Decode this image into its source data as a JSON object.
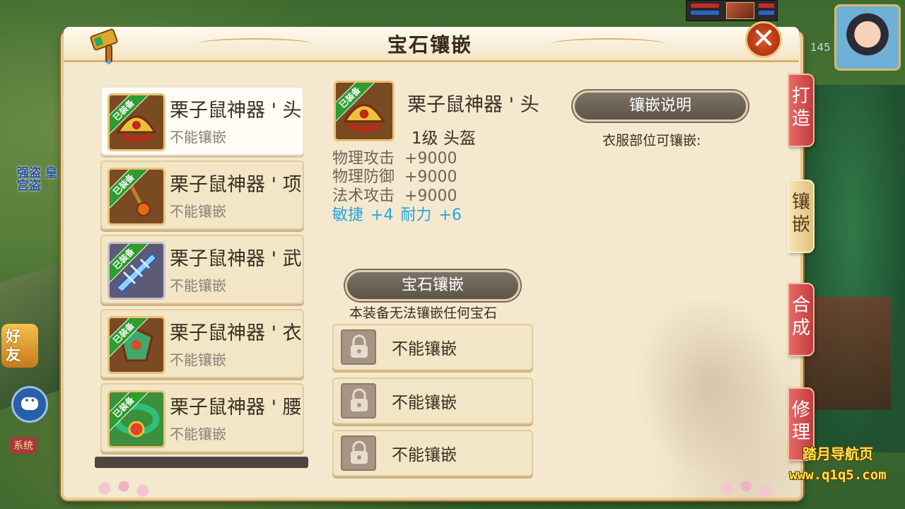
{
  "window": {
    "title": "宝石镶嵌",
    "close_label": "✕"
  },
  "hud": {
    "level": "145",
    "map_name": "强盗 皇宫盗",
    "friends_label": "好友",
    "system_tag": "系统"
  },
  "equipment_list": [
    {
      "name": "栗子鼠神器 ' 头",
      "status": "不能镶嵌",
      "badge": "已装备",
      "icon": "helmet-icon",
      "selected": true
    },
    {
      "name": "栗子鼠神器 ' 项",
      "status": "不能镶嵌",
      "badge": "已装备",
      "icon": "necklace-icon",
      "selected": false
    },
    {
      "name": "栗子鼠神器 ' 武",
      "status": "不能镶嵌",
      "badge": "已装备",
      "icon": "weapon-icon",
      "selected": false
    },
    {
      "name": "栗子鼠神器 ' 衣",
      "status": "不能镶嵌",
      "badge": "已装备",
      "icon": "armor-icon",
      "selected": false
    },
    {
      "name": "栗子鼠神器 ' 腰",
      "status": "不能镶嵌",
      "badge": "已装备",
      "icon": "belt-icon",
      "selected": false
    }
  ],
  "detail": {
    "name": "栗子鼠神器 ' 头",
    "level_type": "1级  头盔",
    "badge": "已装备",
    "stats": [
      {
        "label": "物理攻击",
        "value": "+9000"
      },
      {
        "label": "物理防御",
        "value": "+9000"
      },
      {
        "label": "法术攻击",
        "value": "+9000"
      }
    ],
    "extra": [
      {
        "label": "敏捷",
        "value": "+4"
      },
      {
        "label": "耐力",
        "value": "+6"
      }
    ]
  },
  "inlay_info": {
    "header": "镶嵌说明",
    "text": "衣服部位可镶嵌:"
  },
  "gem_section": {
    "header": "宝石镶嵌",
    "note": "本装备无法镶嵌任何宝石",
    "slots": [
      "不能镶嵌",
      "不能镶嵌",
      "不能镶嵌"
    ]
  },
  "side_tabs": [
    {
      "label": "打造",
      "active": false
    },
    {
      "label": "镶嵌",
      "active": true
    },
    {
      "label": "合成",
      "active": false
    },
    {
      "label": "修理",
      "active": false
    }
  ],
  "watermark": {
    "line1": "踏月导航页",
    "line2": "www.q1q5.com"
  },
  "colors": {
    "panel_bg": "#f4e9cf",
    "badge_green": "#2e9c2e",
    "extra_stat_blue": "#29a3e0",
    "tab_red": "#c33c3c",
    "watermark_yellow": "#ffe14a"
  }
}
